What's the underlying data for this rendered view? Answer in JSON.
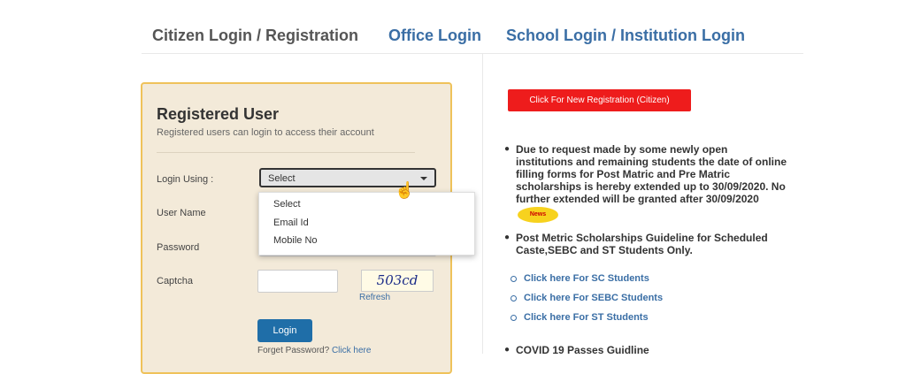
{
  "tabs": {
    "citizen": "Citizen Login / Registration",
    "office": "Office Login",
    "school": "School Login / Institution Login"
  },
  "panel": {
    "title": "Registered User",
    "subtitle": "Registered users can login to access their account",
    "login_using_label": "Login Using :",
    "login_using_value": "Select",
    "login_using_options": [
      "Select",
      "Email Id",
      "Mobile No"
    ],
    "username_label": "User Name",
    "password_label": "Password",
    "captcha_label": "Captcha",
    "captcha_value": "503cd",
    "refresh_label": "Refresh",
    "login_button": "Login",
    "forgot_text": "Forget Password?",
    "forgot_link": "Click here"
  },
  "right": {
    "new_registration_button": "Click For New Registration (Citizen)",
    "notice1_lines": [
      "Due to request made by some newly open",
      "institutions and remaining students the date of online",
      "filling forms for Post Matric and Pre Matric",
      "scholarships is hereby extended up to 30/09/2020. No",
      "further extended will be granted after 30/09/2020"
    ],
    "news_badge": "News",
    "notice2_lines": [
      "Post Metric Scholarships Guideline for Scheduled",
      "Caste,SEBC and ST Students Only."
    ],
    "links": [
      "Click here For SC Students",
      "Click here For SEBC Students",
      "Click here For ST Students"
    ],
    "notice3": "COVID 19 Passes Guidline"
  },
  "colors": {
    "accent_blue": "#3a6ea5",
    "panel_bg": "#f3ead9",
    "panel_border": "#efc25a",
    "register_red": "#ee1c1c",
    "button_blue": "#1f6ea8"
  }
}
